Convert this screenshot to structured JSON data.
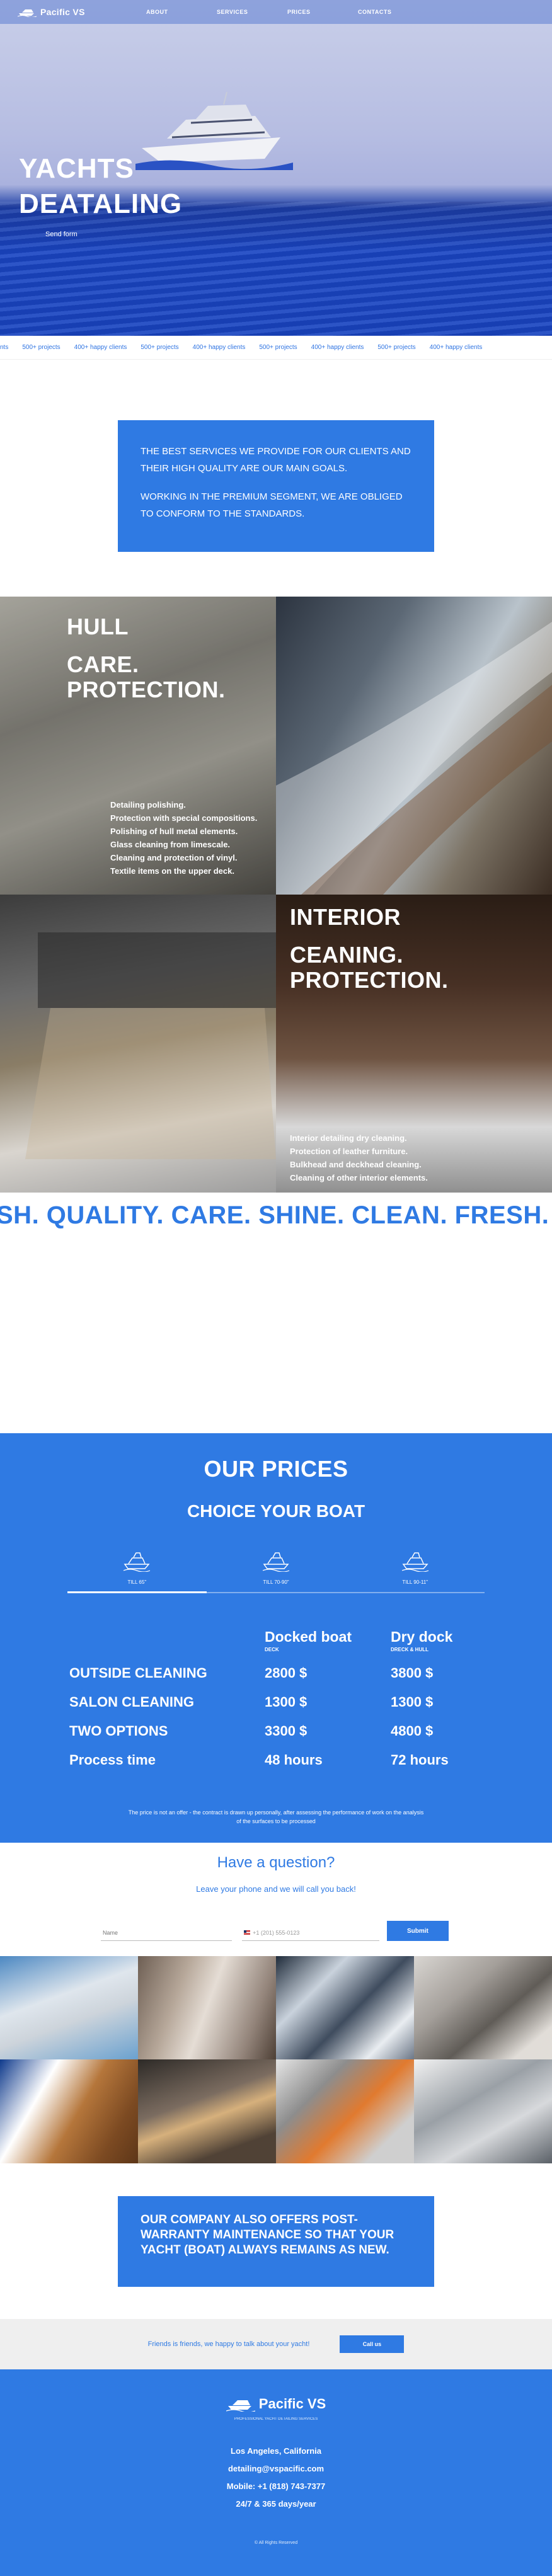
{
  "header": {
    "logo_text": "Pacific VS",
    "nav": [
      "ABOUT",
      "SERVICES",
      "PRICES",
      "CONTACTS"
    ]
  },
  "hero": {
    "title_line1": "YACHTS",
    "title_line2": "DEATALING",
    "link": "Send form"
  },
  "ticker": [
    "nts",
    "500+ projects",
    "400+ happy clients",
    "500+ projects",
    "400+ happy clients",
    "500+ projects",
    "400+ happy clients",
    "500+ projects",
    "400+ happy clients"
  ],
  "mission": {
    "p1": "THE BEST SERVICES WE PROVIDE FOR OUR CLIENTS AND THEIR HIGH QUALITY ARE OUR MAIN GOALS.",
    "p2": "WORKING IN THE PREMIUM SEGMENT, WE ARE OBLIGED TO CONFORM TO THE STANDARDS."
  },
  "hull": {
    "title1": "HULL",
    "title2": "CARE.",
    "title3": "PROTECTION.",
    "items": [
      "Detailing polishing.",
      "Protection with special compositions.",
      "Polishing of hull metal elements.",
      "Glass cleaning from limescale.",
      "Cleaning and protection of vinyl.",
      "Textile items on the upper deck."
    ]
  },
  "interior": {
    "title1": "INTERIOR",
    "title2": "CEANING.",
    "title3": "PROTECTION.",
    "items": [
      "Interior detailing dry cleaning.",
      "Protection of leather furniture.",
      "Bulkhead and deckhead cleaning.",
      "Cleaning of other interior elements."
    ]
  },
  "marquee": "SH. QUALITY. CARE. SHINE. CLEAN. FRESH. QUALITY",
  "prices": {
    "title": "OUR PRICES",
    "subtitle": "CHOICE YOUR BOAT",
    "tabs": [
      "TILL 65\"",
      "TILL 70-90\"",
      "TILL 90-11\""
    ],
    "col1_title": "Docked boat",
    "col1_sub": "DECK",
    "col2_title": "Dry dock",
    "col2_sub": "DRECK & HULL",
    "rows": [
      {
        "label": "OUTSIDE CLEANING",
        "v1": "2800 $",
        "v2": "3800 $"
      },
      {
        "label": "SALON CLEANING",
        "v1": "1300 $",
        "v2": "1300 $"
      },
      {
        "label": "TWO OPTIONS",
        "v1": "3300 $",
        "v2": "4800 $"
      },
      {
        "label": "Process time",
        "v1": "48 hours",
        "v2": "72 hours"
      }
    ],
    "note1": "The price is not an offer - the contract is drawn up personally, after assessing the performance of work on the analysis",
    "note2": "of the surfaces to be processed"
  },
  "question": {
    "title": "Have a question?",
    "subtitle": "Leave your phone and we will call you back!",
    "name_placeholder": "Name",
    "phone_placeholder": "+1 (201) 555-0123",
    "submit": "Submit"
  },
  "warranty": "OUR COMPANY ALSO OFFERS POST-WARRANTY MAINTENANCE SO THAT YOUR YACHT (BOAT) ALWAYS REMAINS AS NEW.",
  "call": {
    "text": "Friends is friends, we happy to talk about your yacht!",
    "button": "Call us"
  },
  "footer": {
    "logo_text": "Pacific VS",
    "tagline": "PROFESSIONAL YACHT DETAILING SERVICES",
    "city": "Los Angeles, California",
    "email": "detailing@vspacific.com",
    "mobile": "Mobile: +1 (818) 743-7377",
    "hours": "24/7 & 365 days/year",
    "copyright": "© All Rights Reserved"
  },
  "colors": {
    "brand_blue": "#2f7ae3"
  }
}
